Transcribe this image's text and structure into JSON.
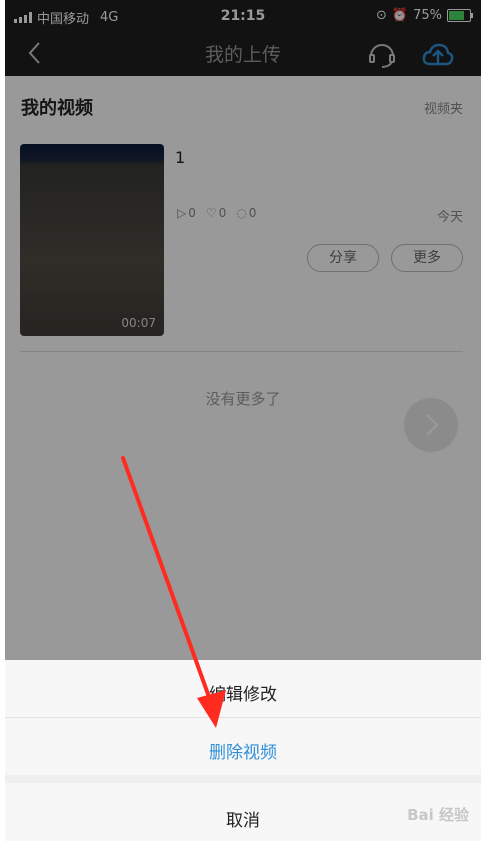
{
  "status": {
    "carrier": "中国移动",
    "network": "4G",
    "time": "21:15",
    "battery": "75%",
    "battery_level": 0.75
  },
  "nav": {
    "title": "我的上传",
    "icons": [
      "back-chevron-icon",
      "headset-icon",
      "cloud-upload-icon"
    ]
  },
  "section": {
    "title": "我的视频",
    "folder_label": "视频夹"
  },
  "video": {
    "title": "1",
    "duration": "00:07",
    "plays": "0",
    "likes": "0",
    "comments": "0",
    "date": "今天",
    "share_label": "分享",
    "more_label": "更多"
  },
  "footer": {
    "no_more": "没有更多了"
  },
  "sheet": {
    "edit": "编辑修改",
    "delete": "删除视频",
    "cancel": "取消"
  },
  "colors": {
    "accent": "#2f8fd8",
    "arrow": "#ff2b1f",
    "bar": "#1f1f1f"
  },
  "watermark": "Bai 经验"
}
